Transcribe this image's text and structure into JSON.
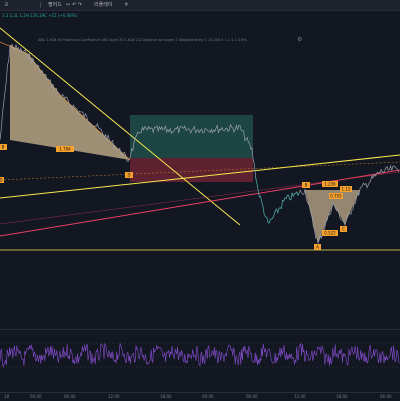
{
  "toolbar": {
    "items": [
      {
        "label": "ㄹ",
        "icon": "menu-glyph"
      },
      {
        "label": "펼어드",
        "icon": "none"
      },
      {
        "label": "↶ ↷",
        "icon": "undo-redo-icon"
      },
      {
        "label": "리플레이",
        "icon": "replay-icon"
      },
      {
        "label": "↩",
        "icon": "undo-icon"
      },
      {
        "label": "ㅎ",
        "icon": "none"
      }
    ]
  },
  "legend": {
    "ohlc_text": "1.2 1,2L 1.2H 126,19C +51 (+0.08%)",
    "indicator_text": "ABC 1.618 50 Harmonic Confluence 062 style 30 1.618 2.2 Distance to target 1 Stopped entry 1 15,200 4 1.1 1.1 0.6%",
    "indicator_settings_icon": "gear-icon"
  },
  "colors": {
    "background": "#131722",
    "yellow": "#f7e94f",
    "pink": "#e84060",
    "orange": "#f7a12b",
    "pattern_fill": "#c2ac8a",
    "price_line": "#9aa0ad",
    "zone_top": "#1e4d4a",
    "zone_bottom": "#6b2332",
    "oscillator": "#8a4fd6"
  },
  "pattern_labels": [
    {
      "text": "B",
      "ref": "left-b"
    },
    {
      "text": "1.784",
      "ref": "left-ratio"
    },
    {
      "text": "D",
      "ref": "left-d"
    },
    {
      "text": "D",
      "ref": "left-d-axis"
    },
    {
      "text": "B",
      "ref": "right-b"
    },
    {
      "text": "1.236",
      "ref": "right-ratio-top"
    },
    {
      "text": "0.705",
      "ref": "right-ratio-left"
    },
    {
      "text": "1.15",
      "ref": "right-ratio-right"
    },
    {
      "text": "0.522",
      "ref": "right-ratio-bottom"
    },
    {
      "text": "C",
      "ref": "right-c"
    },
    {
      "text": "A",
      "ref": "right-a"
    }
  ],
  "x_axis": {
    "ticks": [
      "28",
      "00:00",
      "06:00",
      "12:00",
      "18:00",
      "00:00",
      "06:00",
      "12:00",
      "18:00",
      "06:00"
    ]
  }
}
